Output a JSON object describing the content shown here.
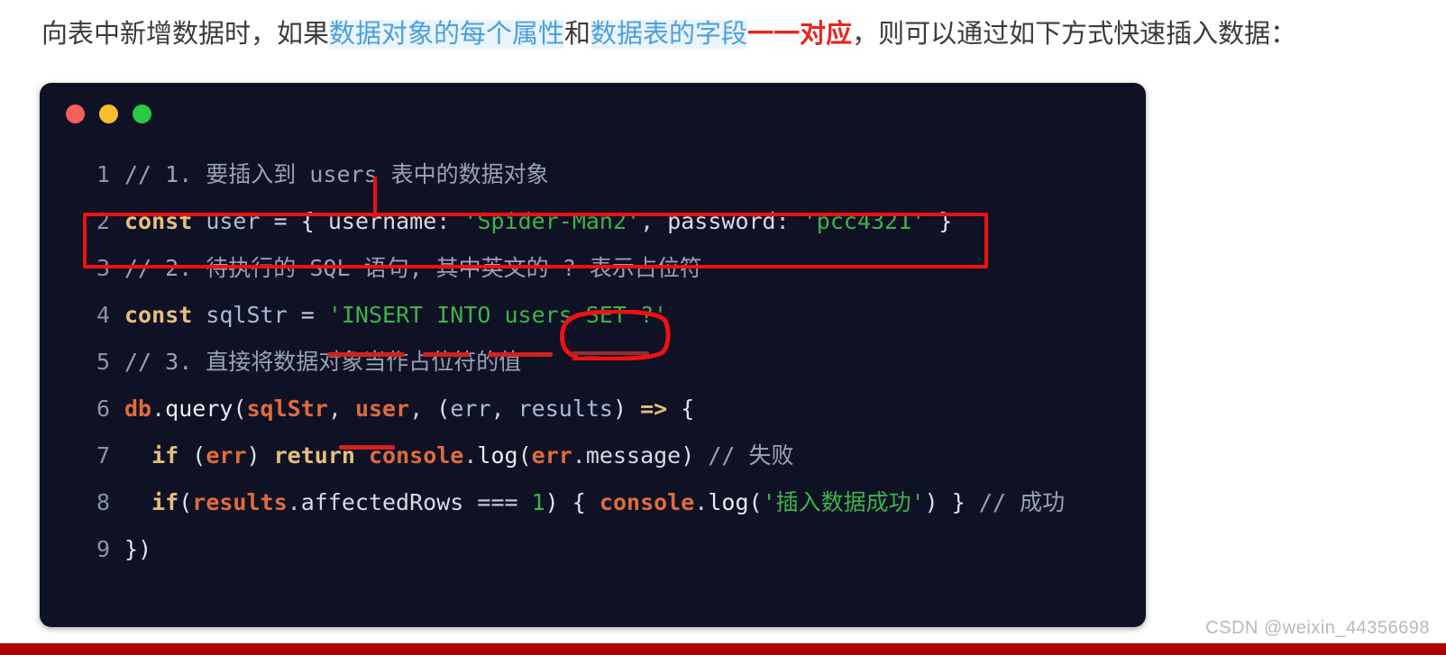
{
  "heading": {
    "parts": [
      {
        "text": "向表中新增数据时，如果",
        "style": "plain"
      },
      {
        "text": "数据对象的每个属性",
        "style": "blue"
      },
      {
        "text": "和",
        "style": "plain"
      },
      {
        "text": "数据表的字段",
        "style": "blue"
      },
      {
        "text": "一一对应",
        "style": "red"
      },
      {
        "text": "，则可以通过如下方式快速插入数据：",
        "style": "plain"
      }
    ],
    "full_text": "向表中新增数据时，如果数据对象的每个属性和数据表的字段一一对应，则可以通过如下方式快速插入数据："
  },
  "window": {
    "traffic_lights": [
      {
        "name": "close",
        "color": "#f4605c"
      },
      {
        "name": "minimize",
        "color": "#fbbd2e"
      },
      {
        "name": "maximize",
        "color": "#2cc940"
      }
    ],
    "background": "#0f1124"
  },
  "code": {
    "language": "javascript",
    "lines": [
      {
        "number": "1",
        "tokens": [
          {
            "t": "// 1. 要插入到 users 表中的数据对象",
            "c": "comment"
          }
        ]
      },
      {
        "number": "2",
        "tokens": [
          {
            "t": "const",
            "c": "kw"
          },
          {
            "t": " ",
            "c": "plain"
          },
          {
            "t": "user",
            "c": "var"
          },
          {
            "t": " ",
            "c": "plain"
          },
          {
            "t": "=",
            "c": "op"
          },
          {
            "t": " ",
            "c": "plain"
          },
          {
            "t": "{",
            "c": "punct"
          },
          {
            "t": " ",
            "c": "plain"
          },
          {
            "t": "username",
            "c": "prop"
          },
          {
            "t": ":",
            "c": "op"
          },
          {
            "t": " ",
            "c": "plain"
          },
          {
            "t": "'Spider-Man2'",
            "c": "str"
          },
          {
            "t": ",",
            "c": "op"
          },
          {
            "t": " ",
            "c": "plain"
          },
          {
            "t": "password",
            "c": "prop"
          },
          {
            "t": ":",
            "c": "op"
          },
          {
            "t": " ",
            "c": "plain"
          },
          {
            "t": "'pcc4321'",
            "c": "str"
          },
          {
            "t": " ",
            "c": "plain"
          },
          {
            "t": "}",
            "c": "punct"
          }
        ]
      },
      {
        "number": "3",
        "tokens": [
          {
            "t": "// 2. 待执行的 SQL 语句, 其中英文的 ? 表示占位符",
            "c": "comment"
          }
        ]
      },
      {
        "number": "4",
        "tokens": [
          {
            "t": "const",
            "c": "kw"
          },
          {
            "t": " ",
            "c": "plain"
          },
          {
            "t": "sqlStr",
            "c": "var"
          },
          {
            "t": " ",
            "c": "plain"
          },
          {
            "t": "=",
            "c": "op"
          },
          {
            "t": " ",
            "c": "plain"
          },
          {
            "t": "'INSERT INTO users SET ?'",
            "c": "str"
          }
        ]
      },
      {
        "number": "5",
        "tokens": [
          {
            "t": "// 3. 直接将数据对象当作占位符的值",
            "c": "comment"
          }
        ]
      },
      {
        "number": "6",
        "tokens": [
          {
            "t": "db",
            "c": "obj"
          },
          {
            "t": ".",
            "c": "op"
          },
          {
            "t": "query",
            "c": "fn"
          },
          {
            "t": "(",
            "c": "punct"
          },
          {
            "t": "sqlStr",
            "c": "obj"
          },
          {
            "t": ",",
            "c": "op"
          },
          {
            "t": " ",
            "c": "plain"
          },
          {
            "t": "user",
            "c": "obj"
          },
          {
            "t": ",",
            "c": "op"
          },
          {
            "t": " ",
            "c": "plain"
          },
          {
            "t": "(",
            "c": "punct"
          },
          {
            "t": "err",
            "c": "var"
          },
          {
            "t": ",",
            "c": "op"
          },
          {
            "t": " ",
            "c": "plain"
          },
          {
            "t": "results",
            "c": "var"
          },
          {
            "t": ")",
            "c": "punct"
          },
          {
            "t": " ",
            "c": "plain"
          },
          {
            "t": "=>",
            "c": "kw"
          },
          {
            "t": " ",
            "c": "plain"
          },
          {
            "t": "{",
            "c": "punct"
          }
        ]
      },
      {
        "number": "7",
        "tokens": [
          {
            "t": "  ",
            "c": "plain"
          },
          {
            "t": "if",
            "c": "kw"
          },
          {
            "t": " ",
            "c": "plain"
          },
          {
            "t": "(",
            "c": "punct"
          },
          {
            "t": "err",
            "c": "obj"
          },
          {
            "t": ")",
            "c": "punct"
          },
          {
            "t": " ",
            "c": "plain"
          },
          {
            "t": "return",
            "c": "kw"
          },
          {
            "t": " ",
            "c": "plain"
          },
          {
            "t": "console",
            "c": "obj"
          },
          {
            "t": ".",
            "c": "op"
          },
          {
            "t": "log",
            "c": "fn"
          },
          {
            "t": "(",
            "c": "punct"
          },
          {
            "t": "err",
            "c": "obj"
          },
          {
            "t": ".",
            "c": "op"
          },
          {
            "t": "message",
            "c": "prop"
          },
          {
            "t": ")",
            "c": "punct"
          },
          {
            "t": " ",
            "c": "plain"
          },
          {
            "t": "// 失败",
            "c": "comment"
          }
        ]
      },
      {
        "number": "8",
        "tokens": [
          {
            "t": "  ",
            "c": "plain"
          },
          {
            "t": "if",
            "c": "kw"
          },
          {
            "t": "(",
            "c": "punct"
          },
          {
            "t": "results",
            "c": "obj"
          },
          {
            "t": ".",
            "c": "op"
          },
          {
            "t": "affectedRows",
            "c": "prop"
          },
          {
            "t": " ",
            "c": "plain"
          },
          {
            "t": "===",
            "c": "op"
          },
          {
            "t": " ",
            "c": "plain"
          },
          {
            "t": "1",
            "c": "num"
          },
          {
            "t": ")",
            "c": "punct"
          },
          {
            "t": " ",
            "c": "plain"
          },
          {
            "t": "{",
            "c": "punct"
          },
          {
            "t": " ",
            "c": "plain"
          },
          {
            "t": "console",
            "c": "obj"
          },
          {
            "t": ".",
            "c": "op"
          },
          {
            "t": "log",
            "c": "fn"
          },
          {
            "t": "(",
            "c": "punct"
          },
          {
            "t": "'插入数据成功'",
            "c": "str"
          },
          {
            "t": ")",
            "c": "punct"
          },
          {
            "t": " ",
            "c": "plain"
          },
          {
            "t": "}",
            "c": "punct"
          },
          {
            "t": " ",
            "c": "plain"
          },
          {
            "t": "// 成功",
            "c": "comment"
          }
        ]
      },
      {
        "number": "9",
        "tokens": [
          {
            "t": "}",
            "c": "punct"
          },
          {
            "t": ")",
            "c": "punct"
          }
        ]
      }
    ]
  },
  "annotations": {
    "color": "#ee1111",
    "rect_target_line": "2",
    "circle_target_text": "SET ?'",
    "underline_targets": [
      "INSERT",
      "INTO",
      "users",
      "user"
    ]
  },
  "watermark": {
    "text": "CSDN @weixin_44356698"
  },
  "footer": {
    "color": "#b20000"
  }
}
